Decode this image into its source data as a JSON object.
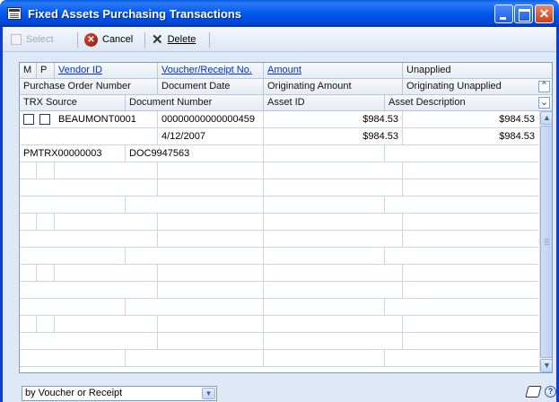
{
  "window": {
    "title": "Fixed Assets Purchasing Transactions",
    "close_glyph": "✕"
  },
  "toolbar": {
    "select_label": "Select",
    "cancel_label": "Cancel",
    "delete_label": "Delete",
    "cancel_glyph": "✕",
    "delete_glyph": "✕"
  },
  "grid": {
    "header_row1": {
      "m": "M",
      "p": "P",
      "vendor_id": "Vendor ID",
      "voucher": "Voucher/Receipt No.",
      "amount": "Amount",
      "unapplied": "Unapplied"
    },
    "header_row2": {
      "po_number": "Purchase Order Number",
      "document_date": "Document Date",
      "originating_amount": "Originating Amount",
      "originating_unapplied": "Originating Unapplied",
      "collapse_glyph": "⌃"
    },
    "header_row3": {
      "trx_source": "TRX Source",
      "document_number": "Document Number",
      "asset_id": "Asset ID",
      "asset_description": "Asset Description",
      "expand_glyph": "⌄"
    },
    "record": {
      "vendor_id": "BEAUMONT0001",
      "voucher": "00000000000000459",
      "amount": "$984.53",
      "unapplied": "$984.53",
      "document_date": "4/12/2007",
      "originating_amount": "$984.53",
      "originating_unapplied": "$984.53",
      "trx_source": "PMTRX00000003",
      "document_number": "DOC9947563"
    },
    "scroll_up_glyph": "▲",
    "scroll_down_glyph": "▼"
  },
  "status": {
    "sort_by": "by Voucher or Receipt",
    "dropdown_glyph": "▼",
    "help_glyph": "?"
  },
  "icons": [
    "app-window-icon",
    "select-icon",
    "cancel-icon",
    "delete-icon",
    "note-icon",
    "help-icon"
  ]
}
